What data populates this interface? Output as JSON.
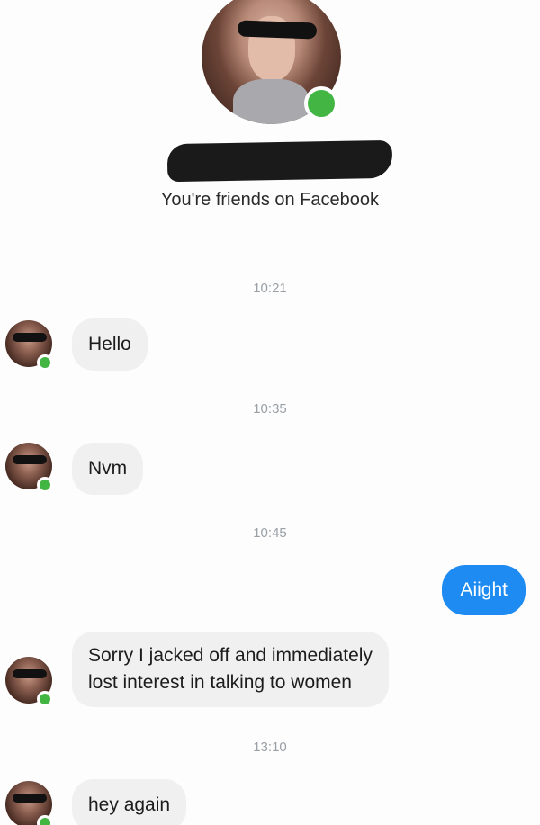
{
  "header": {
    "friends_text": "You're friends on Facebook"
  },
  "messages": [
    {
      "timestamp": "10:21",
      "from": "them",
      "text": "Hello"
    },
    {
      "timestamp": "10:35",
      "from": "them",
      "text": "Nvm"
    },
    {
      "timestamp": "10:45",
      "from": "me",
      "text": "Aiight"
    },
    {
      "from": "them",
      "lines": [
        "Sorry I jacked off and immediately",
        "lost interest in talking to women"
      ]
    },
    {
      "timestamp": "13:10",
      "from": "them",
      "text": "hey again"
    }
  ],
  "colors": {
    "outgoing_bubble": "#1d8bf1",
    "incoming_bubble": "#f0f0f0",
    "online_indicator": "#43b543",
    "timestamp_text": "#9aa0a6"
  },
  "icons": {
    "online": "online-status-dot-icon"
  }
}
